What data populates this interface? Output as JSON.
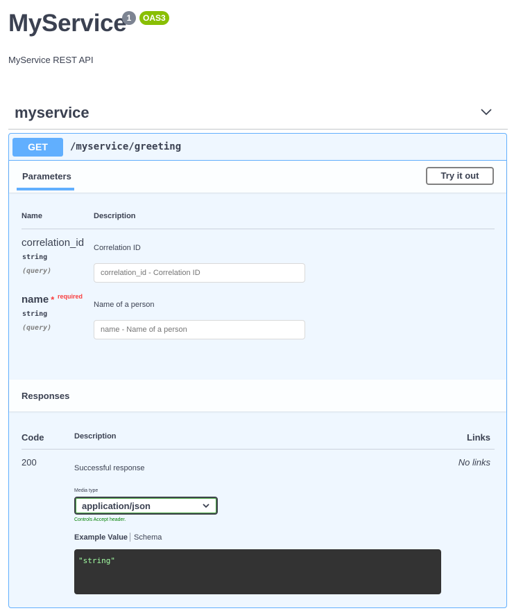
{
  "header": {
    "title": "MyService",
    "version": "1",
    "oas_badge": "OAS3",
    "description": "MyService REST API"
  },
  "tag": {
    "name": "myservice",
    "chevron_icon": "chevron-down-icon"
  },
  "operation": {
    "method": "GET",
    "path": "/myservice/greeting"
  },
  "parameters": {
    "tab_label": "Parameters",
    "try_button": "Try it out",
    "col_name": "Name",
    "col_description": "Description",
    "items": [
      {
        "name": "correlation_id",
        "required": false,
        "type": "string",
        "in": "(query)",
        "description": "Correlation ID",
        "placeholder": "correlation_id - Correlation ID"
      },
      {
        "name": "name",
        "required": true,
        "required_star": "*",
        "required_label": "required",
        "type": "string",
        "in": "(query)",
        "description": "Name of a person",
        "placeholder": "name - Name of a person"
      }
    ]
  },
  "responses": {
    "title": "Responses",
    "col_code": "Code",
    "col_description": "Description",
    "col_links": "Links",
    "items": [
      {
        "code": "200",
        "description": "Successful response",
        "links": "No links",
        "media_type_label": "Media type",
        "media_type": "application/json",
        "controls_note": "Controls Accept header.",
        "example_tab": "Example Value",
        "schema_tab": "Schema",
        "example": "\"string\""
      }
    ]
  },
  "colors": {
    "get_blue": "#61affe",
    "oas_green": "#89bf04",
    "required_red": "#f93e3e",
    "code_bg": "#333333",
    "code_text": "#a2fca2"
  }
}
